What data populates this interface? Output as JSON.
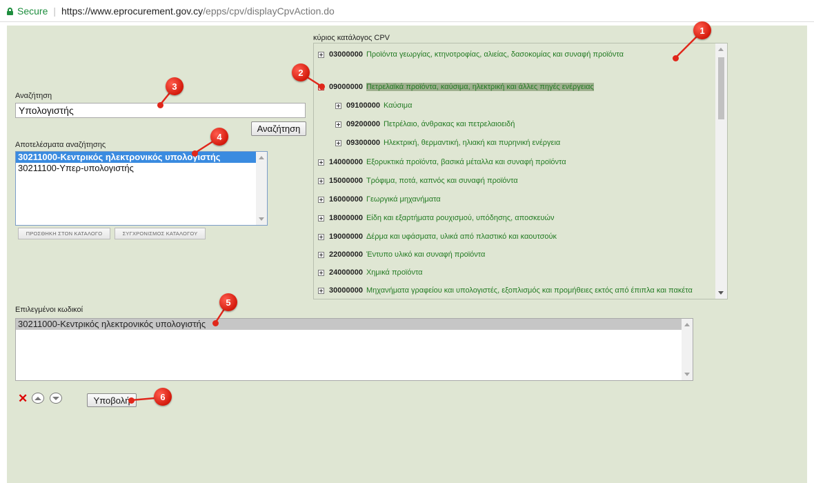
{
  "browser": {
    "secure_label": "Secure",
    "url_host": "https://www.eprocurement.gov.cy",
    "url_path": "/epps/cpv/displayCpvAction.do"
  },
  "search": {
    "label": "Αναζήτηση",
    "value": "Υπολογιστής",
    "button_label": "Αναζήτηση"
  },
  "results": {
    "label": "Αποτελέσματα αναζήτησης",
    "items": [
      "30211000-Κεντρικός ηλεκτρονικός υπολογιστής",
      "30211100-Υπερ-υπολογιστής"
    ],
    "add_button": "ΠΡΟΣΘΗΚΗ ΣΤΟΝ ΚΑΤΑΛΟΓΟ",
    "sync_button": "ΣΥΓΧΡΟΝΙΣΜΟΣ ΚΑΤΑΛΟΓΟΥ"
  },
  "catalog": {
    "label": "κύριος κατάλογος CPV",
    "nodes": [
      {
        "code": "03000000",
        "desc": "Προϊόντα γεωργίας, κτηνοτροφίας, αλιείας, δασοκομίας και συναφή προϊόντα"
      },
      {
        "code": "09000000",
        "desc": "Πετρελαϊκά προϊόντα, καύσιμα, ηλεκτρική και άλλες πηγές ενέργειας"
      },
      {
        "code": "09100000",
        "desc": "Καύσιμα"
      },
      {
        "code": "09200000",
        "desc": "Πετρέλαιο, άνθρακας και πετρελαιοειδή"
      },
      {
        "code": "09300000",
        "desc": "Ηλεκτρική, θερμαντική, ηλιακή και πυρηνική ενέργεια"
      },
      {
        "code": "14000000",
        "desc": "Εξορυκτικά προϊόντα, βασικά μέταλλα και συναφή προϊόντα"
      },
      {
        "code": "15000000",
        "desc": "Τρόφιμα, ποτά, καπνός και συναφή προϊόντα"
      },
      {
        "code": "16000000",
        "desc": "Γεωργικά μηχανήματα"
      },
      {
        "code": "18000000",
        "desc": "Είδη και εξαρτήματα ρουχισμού, υπόδησης, αποσκευών"
      },
      {
        "code": "19000000",
        "desc": "Δέρμα και υφάσματα, υλικά από πλαστικό και καουτσούκ"
      },
      {
        "code": "22000000",
        "desc": "Έντυπο υλικό και συναφή προϊόντα"
      },
      {
        "code": "24000000",
        "desc": "Χημικά προϊόντα"
      },
      {
        "code": "30000000",
        "desc": "Μηχανήματα γραφείου και υπολογιστές, εξοπλισμός και προμήθειες εκτός από έπιπλα και πακέτα"
      }
    ]
  },
  "selected": {
    "label": "Επιλεγμένοι κωδικοί",
    "items": [
      "30211000-Κεντρικός ηλεκτρονικός υπολογιστής"
    ]
  },
  "actions": {
    "submit_label": "Υποβολή",
    "remove_icon": "close-icon",
    "move_up_icon": "move-up-icon",
    "move_down_icon": "move-down-icon"
  },
  "callouts": [
    "1",
    "2",
    "3",
    "4",
    "5",
    "6"
  ],
  "colors": {
    "panel_bg": "#dfe6d3",
    "link_green": "#237a23",
    "callout_red": "#d41a0c",
    "selection_blue": "#3a8be0"
  }
}
